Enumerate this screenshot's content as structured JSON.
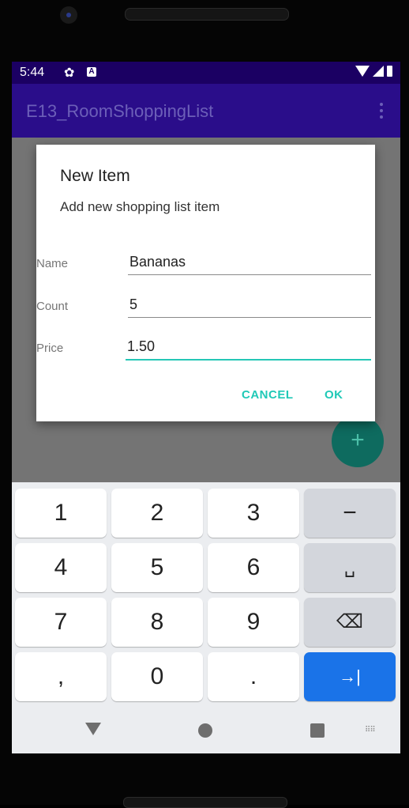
{
  "status_bar": {
    "time": "5:44"
  },
  "app_bar": {
    "title": "E13_RoomShoppingList"
  },
  "fab": {
    "label": "+"
  },
  "dialog": {
    "title": "New Item",
    "message": "Add new shopping list item",
    "fields": {
      "name": {
        "label": "Name",
        "value": "Bananas"
      },
      "count": {
        "label": "Count",
        "value": "5"
      },
      "price": {
        "label": "Price",
        "value": "1.50"
      }
    },
    "cancel_label": "CANCEL",
    "ok_label": "OK"
  },
  "keyboard": {
    "keys": [
      "1",
      "2",
      "3",
      "−",
      "4",
      "5",
      "6",
      "␣",
      "7",
      "8",
      "9",
      "⌫",
      ",",
      "0",
      ".",
      "→|"
    ]
  },
  "colors": {
    "status_bar": "#1b0063",
    "app_bar": "#2a0d8a",
    "accent": "#20c9b7",
    "enter_key": "#1a73e8"
  }
}
